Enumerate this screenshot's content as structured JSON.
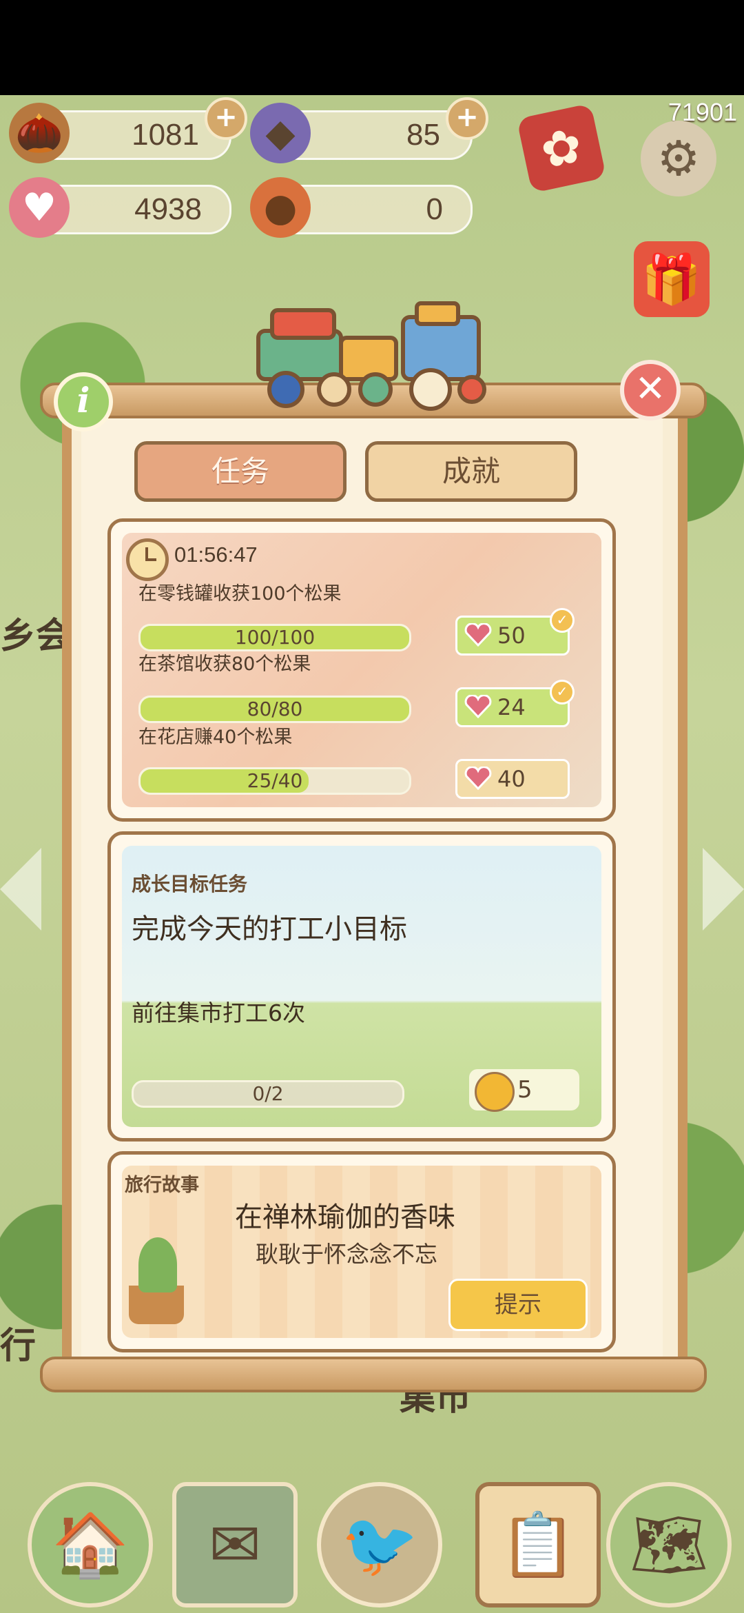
{
  "resources": {
    "acorn": {
      "icon": "acorn-icon",
      "value": "1081"
    },
    "gem": {
      "icon": "gem-icon",
      "value": "85"
    },
    "heart": {
      "icon": "heart-gem-icon",
      "value": "4938"
    },
    "persimmon": {
      "icon": "persimmon-icon",
      "value": "0"
    }
  },
  "score": "71901",
  "map_labels": {
    "left_top": "乡会",
    "left_bottom": "行",
    "center_bottom": "集市"
  },
  "tabs": [
    {
      "label": "任务",
      "active": true
    },
    {
      "label": "成就",
      "active": false
    }
  ],
  "daily": {
    "timer": "01:56:47",
    "tasks": [
      {
        "title": "在零钱罐收获100个松果",
        "progress_text": "100/100",
        "progress": 1.0,
        "reward": "50",
        "claimed": true
      },
      {
        "title": "在茶馆收获80个松果",
        "progress_text": "80/80",
        "progress": 1.0,
        "reward": "24",
        "claimed": true
      },
      {
        "title": "在花店赚40个松果",
        "progress_text": "25/40",
        "progress": 0.625,
        "reward": "40",
        "claimed": false
      }
    ]
  },
  "growth": {
    "section": "成长目标任务",
    "title": "完成今天的打工小目标",
    "task": "前往集市打工6次",
    "progress_text": "0/2",
    "progress": 0.0,
    "reward": "5"
  },
  "travel": {
    "section": "旅行故事",
    "title": "在禅林瑜伽的香味",
    "subtitle": "耿耿于怀念念不忘",
    "button": "提示"
  },
  "colors": {
    "accent": "#e6a680",
    "panel": "#f8edd4",
    "border": "#a0754a",
    "close": "#e9726a",
    "info": "#9fcf6a"
  }
}
